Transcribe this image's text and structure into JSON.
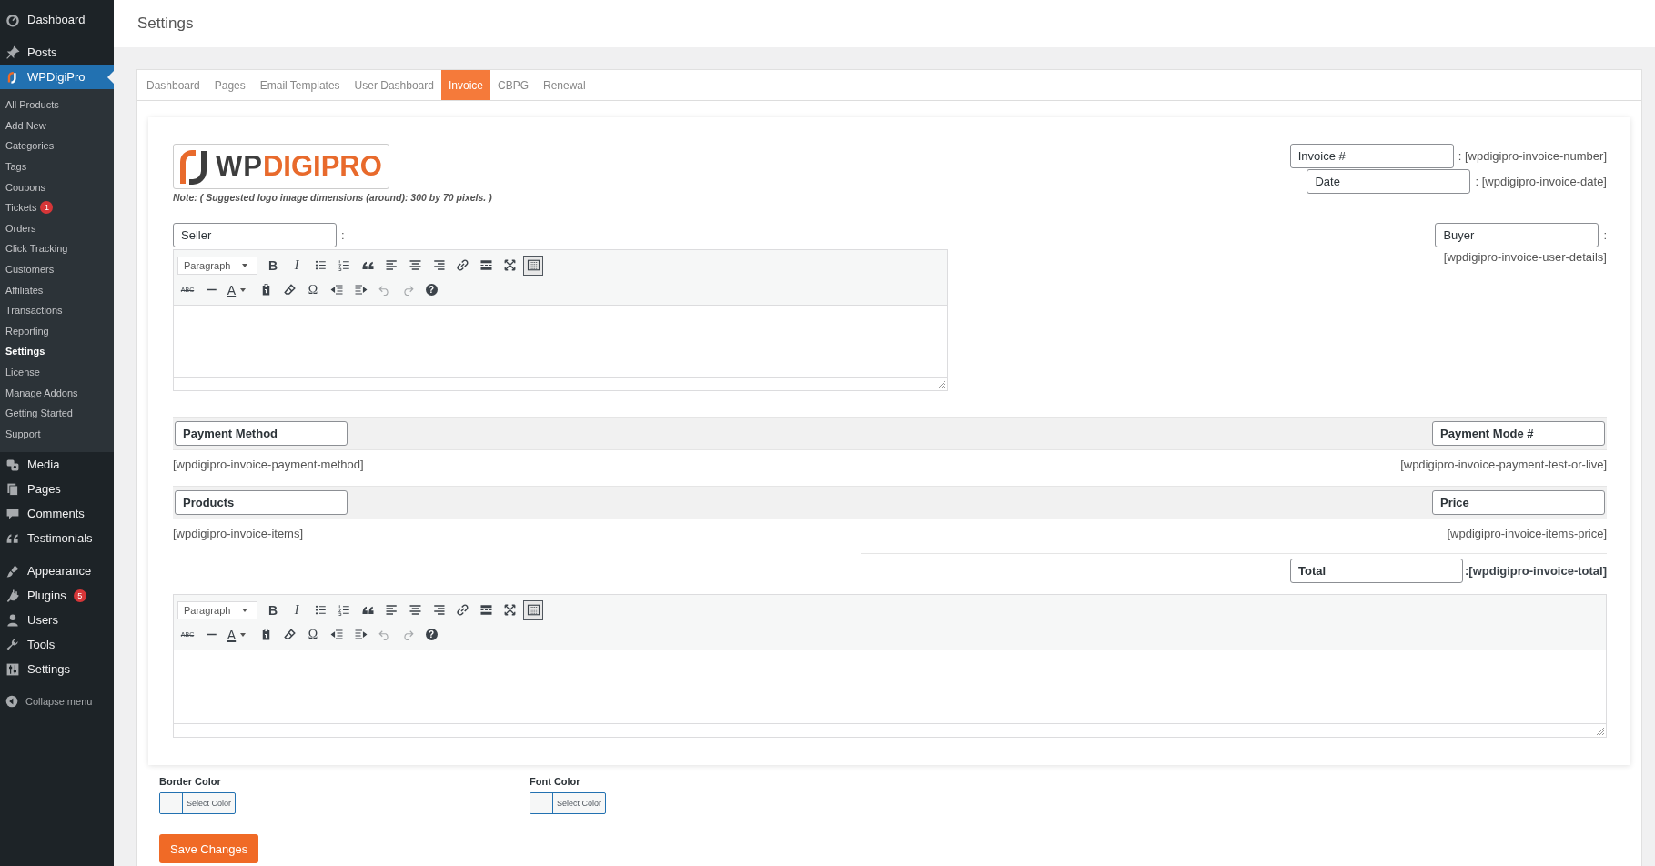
{
  "sidebar": {
    "groups": [
      {
        "items": [
          {
            "label": "Dashboard",
            "kind": "dashboard",
            "selected": false
          }
        ]
      },
      {
        "items": [
          {
            "label": "Posts",
            "kind": "posts",
            "selected": false
          },
          {
            "label": "WPDigiPro",
            "kind": "plugin-logo",
            "selected": true,
            "children": [
              {
                "label": "All Products",
                "selected": false
              },
              {
                "label": "Add New",
                "selected": false
              },
              {
                "label": "Categories",
                "selected": false
              },
              {
                "label": "Tags",
                "selected": false
              },
              {
                "label": "Coupons",
                "selected": false
              },
              {
                "label": "Tickets",
                "badge": "1",
                "selected": false
              },
              {
                "label": "Orders",
                "selected": false
              },
              {
                "label": "Click Tracking",
                "selected": false
              },
              {
                "label": "Customers",
                "selected": false
              },
              {
                "label": "Affiliates",
                "selected": false
              },
              {
                "label": "Transactions",
                "selected": false
              },
              {
                "label": "Reporting",
                "selected": false
              },
              {
                "label": "Settings",
                "selected": true
              },
              {
                "label": "License",
                "selected": false
              },
              {
                "label": "Manage Addons",
                "selected": false
              },
              {
                "label": "Getting Started",
                "selected": false
              },
              {
                "label": "Support",
                "selected": false
              }
            ]
          },
          {
            "label": "Media",
            "kind": "media",
            "selected": false
          },
          {
            "label": "Pages",
            "kind": "pages",
            "selected": false
          },
          {
            "label": "Comments",
            "kind": "comments",
            "selected": false
          },
          {
            "label": "Testimonials",
            "kind": "quote",
            "selected": false
          }
        ]
      },
      {
        "items": [
          {
            "label": "Appearance",
            "kind": "appearance",
            "selected": false
          },
          {
            "label": "Plugins",
            "kind": "plugins",
            "badge": "5",
            "selected": false
          },
          {
            "label": "Users",
            "kind": "users",
            "selected": false
          },
          {
            "label": "Tools",
            "kind": "tools",
            "selected": false
          },
          {
            "label": "Settings",
            "kind": "settings",
            "selected": false
          }
        ]
      }
    ],
    "collapse": "Collapse menu"
  },
  "page_title": "Settings",
  "tabs": [
    {
      "label": "Dashboard",
      "selected": false
    },
    {
      "label": "Pages",
      "selected": false
    },
    {
      "label": "Email Templates",
      "selected": false
    },
    {
      "label": "User Dashboard",
      "selected": false
    },
    {
      "label": "Invoice",
      "selected": true
    },
    {
      "label": "CBPG",
      "selected": false
    },
    {
      "label": "Renewal",
      "selected": false
    }
  ],
  "logo": {
    "text_1": "WP",
    "text_2": "DIGIPRO",
    "note": "Note: ( Suggested logo image dimensions (around): 300 by 70 pixels. )"
  },
  "invoice_number": {
    "value": "Invoice #",
    "shortcode": ": [wpdigipro-invoice-number]"
  },
  "invoice_date": {
    "value": "Date",
    "shortcode": ": [wpdigipro-invoice-date]"
  },
  "seller": {
    "value": "Seller",
    "suffix": ":"
  },
  "buyer": {
    "value": "Buyer",
    "suffix": ":",
    "shortcode": "[wpdigipro-invoice-user-details]"
  },
  "sections": [
    {
      "left_label": "Payment Method",
      "right_label": "Payment Mode #",
      "left_value": "[wpdigipro-invoice-payment-method]",
      "right_value": "[wpdigipro-invoice-payment-test-or-live]"
    },
    {
      "left_label": "Products",
      "right_label": "Price",
      "left_value": "[wpdigipro-invoice-items]",
      "right_value": "[wpdigipro-invoice-items-price]"
    }
  ],
  "total": {
    "value": "Total",
    "shortcode": ":[wpdigipro-invoice-total]"
  },
  "editors": [
    {
      "format": "Paragraph",
      "toolbar_rows": [
        {
          "buttons": [
            {
              "kind": "bold",
              "label": "B",
              "on": false,
              "disabled": false
            },
            {
              "kind": "italic",
              "label": "I",
              "on": false,
              "disabled": false
            },
            {
              "kind": "bullet-list",
              "on": false,
              "disabled": false
            },
            {
              "kind": "numbered-list",
              "on": false,
              "disabled": false
            },
            {
              "kind": "blockquote",
              "on": false,
              "disabled": false
            },
            {
              "kind": "align-left",
              "on": false,
              "disabled": false
            },
            {
              "kind": "align-center",
              "on": false,
              "disabled": false
            },
            {
              "kind": "align-right",
              "on": false,
              "disabled": false
            },
            {
              "kind": "link",
              "on": false,
              "disabled": false
            },
            {
              "kind": "read-more",
              "on": false,
              "disabled": false
            },
            {
              "kind": "fullscreen",
              "on": false,
              "disabled": false
            },
            {
              "kind": "toolbar-toggle",
              "on": true,
              "disabled": false
            }
          ]
        },
        {
          "buttons": [
            {
              "kind": "strikethrough",
              "label": "ABC",
              "on": false,
              "disabled": false
            },
            {
              "kind": "horizontal-line",
              "on": false,
              "disabled": false
            },
            {
              "kind": "text-color",
              "label": "A",
              "on": false,
              "disabled": false
            },
            {
              "kind": "paste-text",
              "on": false,
              "disabled": false
            },
            {
              "kind": "clear-formatting",
              "on": false,
              "disabled": false
            },
            {
              "kind": "special-character",
              "label": "Ω",
              "on": false,
              "disabled": false
            },
            {
              "kind": "outdent",
              "on": false,
              "disabled": false
            },
            {
              "kind": "indent",
              "on": false,
              "disabled": false
            },
            {
              "kind": "undo",
              "on": false,
              "disabled": true
            },
            {
              "kind": "redo",
              "on": false,
              "disabled": true
            },
            {
              "kind": "help",
              "label": "?",
              "on": false,
              "disabled": false
            }
          ]
        }
      ]
    },
    {
      "format": "Paragraph",
      "toolbar_rows": [
        {
          "buttons": [
            {
              "kind": "bold",
              "label": "B",
              "on": false,
              "disabled": false
            },
            {
              "kind": "italic",
              "label": "I",
              "on": false,
              "disabled": false
            },
            {
              "kind": "bullet-list",
              "on": false,
              "disabled": false
            },
            {
              "kind": "numbered-list",
              "on": false,
              "disabled": false
            },
            {
              "kind": "blockquote",
              "on": false,
              "disabled": false
            },
            {
              "kind": "align-left",
              "on": false,
              "disabled": false
            },
            {
              "kind": "align-center",
              "on": false,
              "disabled": false
            },
            {
              "kind": "align-right",
              "on": false,
              "disabled": false
            },
            {
              "kind": "link",
              "on": false,
              "disabled": false
            },
            {
              "kind": "read-more",
              "on": false,
              "disabled": false
            },
            {
              "kind": "fullscreen",
              "on": false,
              "disabled": false
            },
            {
              "kind": "toolbar-toggle",
              "on": true,
              "disabled": false
            }
          ]
        },
        {
          "buttons": [
            {
              "kind": "strikethrough",
              "label": "ABC",
              "on": false,
              "disabled": false
            },
            {
              "kind": "horizontal-line",
              "on": false,
              "disabled": false
            },
            {
              "kind": "text-color",
              "label": "A",
              "on": false,
              "disabled": false
            },
            {
              "kind": "paste-text",
              "on": false,
              "disabled": false
            },
            {
              "kind": "clear-formatting",
              "on": false,
              "disabled": false
            },
            {
              "kind": "special-character",
              "label": "Ω",
              "on": false,
              "disabled": false
            },
            {
              "kind": "outdent",
              "on": false,
              "disabled": false
            },
            {
              "kind": "indent",
              "on": false,
              "disabled": false
            },
            {
              "kind": "undo",
              "on": false,
              "disabled": true
            },
            {
              "kind": "redo",
              "on": false,
              "disabled": true
            },
            {
              "kind": "help",
              "label": "?",
              "on": false,
              "disabled": false
            }
          ]
        }
      ]
    }
  ],
  "color_pickers": [
    {
      "label": "Border Color",
      "button": "Select Color"
    },
    {
      "label": "Font Color",
      "button": "Select Color"
    }
  ],
  "save_button": "Save Changes"
}
